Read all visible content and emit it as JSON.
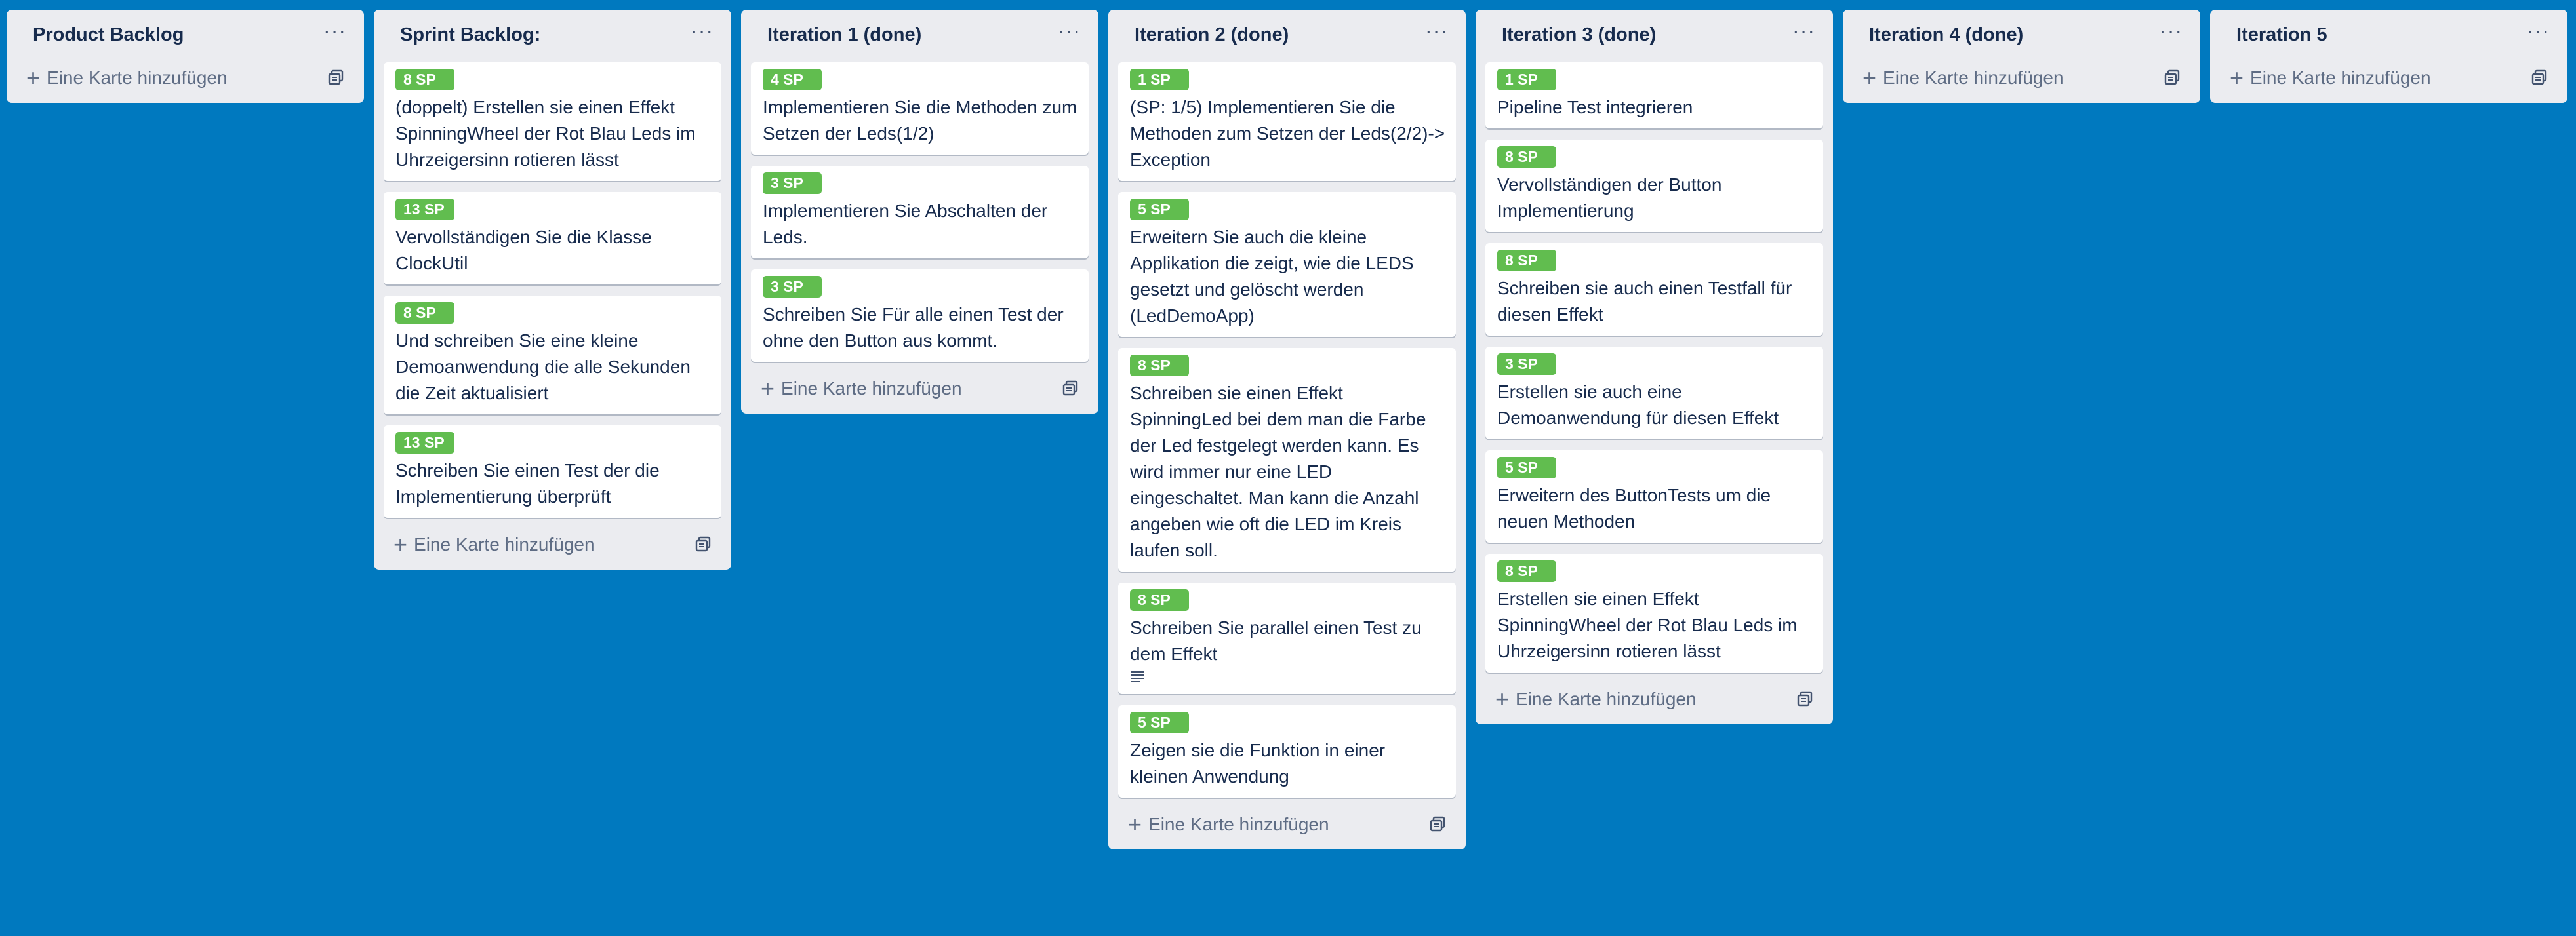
{
  "add_card_label": "Eine Karte hinzufügen",
  "menu_glyph": "···",
  "colors": {
    "board_bg": "#0079bf",
    "list_bg": "#ebecf0",
    "label_green": "#61bd4f"
  },
  "lists": [
    {
      "title": "Product Backlog",
      "cards": []
    },
    {
      "title": "Sprint Backlog:",
      "cards": [
        {
          "label": "8 SP",
          "text": "(doppelt) Erstellen sie einen Effekt SpinningWheel der Rot Blau Leds im Uhrzeigersinn rotieren lässt"
        },
        {
          "label": "13 SP",
          "text": "Vervollständigen Sie die Klasse ClockUtil"
        },
        {
          "label": "8 SP",
          "text": "Und schreiben Sie eine kleine Demoanwendung die alle Sekunden die Zeit aktualisiert"
        },
        {
          "label": "13 SP",
          "text": "Schreiben Sie einen Test der die Implementierung überprüft"
        }
      ]
    },
    {
      "title": "Iteration 1 (done)",
      "cards": [
        {
          "label": "4 SP",
          "text": "Implementieren Sie die Methoden zum Setzen der Leds(1/2)"
        },
        {
          "label": "3 SP",
          "text": "Implementieren Sie Abschalten der Leds."
        },
        {
          "label": "3 SP",
          "text": "Schreiben Sie Für alle einen Test der ohne den Button aus kommt."
        }
      ]
    },
    {
      "title": "Iteration 2 (done)",
      "cards": [
        {
          "label": "1 SP",
          "text": "(SP: 1/5) Implementieren Sie die Methoden zum Setzen der Leds(2/2)-> Exception"
        },
        {
          "label": "5 SP",
          "text": "Erweitern Sie auch die kleine Applikation die zeigt, wie die LEDS gesetzt und gelöscht werden (LedDemoApp)"
        },
        {
          "label": "8 SP",
          "text": "Schreiben sie einen Effekt SpinningLed bei dem man die Farbe der Led festgelegt werden kann. Es wird immer nur eine LED eingeschaltet. Man kann die Anzahl angeben wie oft die LED im Kreis laufen soll."
        },
        {
          "label": "8 SP",
          "text": "Schreiben Sie parallel einen Test zu dem Effekt",
          "has_description": true
        },
        {
          "label": "5 SP",
          "text": "Zeigen sie die Funktion in einer kleinen Anwendung"
        }
      ]
    },
    {
      "title": "Iteration 3 (done)",
      "cards": [
        {
          "label": "1 SP",
          "text": "Pipeline Test integrieren"
        },
        {
          "label": "8 SP",
          "text": "Vervollständigen der Button Implementierung"
        },
        {
          "label": "8 SP",
          "text": "Schreiben sie auch einen Testfall für diesen Effekt"
        },
        {
          "label": "3 SP",
          "text": "Erstellen sie auch eine Demoanwendung für diesen Effekt"
        },
        {
          "label": "5 SP",
          "text": "Erweitern des ButtonTests um die neuen Methoden"
        },
        {
          "label": "8 SP",
          "text": "Erstellen sie einen Effekt SpinningWheel der Rot Blau Leds im Uhrzeigersinn rotieren lässt"
        }
      ]
    },
    {
      "title": "Iteration 4 (done)",
      "cards": []
    },
    {
      "title": "Iteration 5",
      "cards": []
    }
  ]
}
